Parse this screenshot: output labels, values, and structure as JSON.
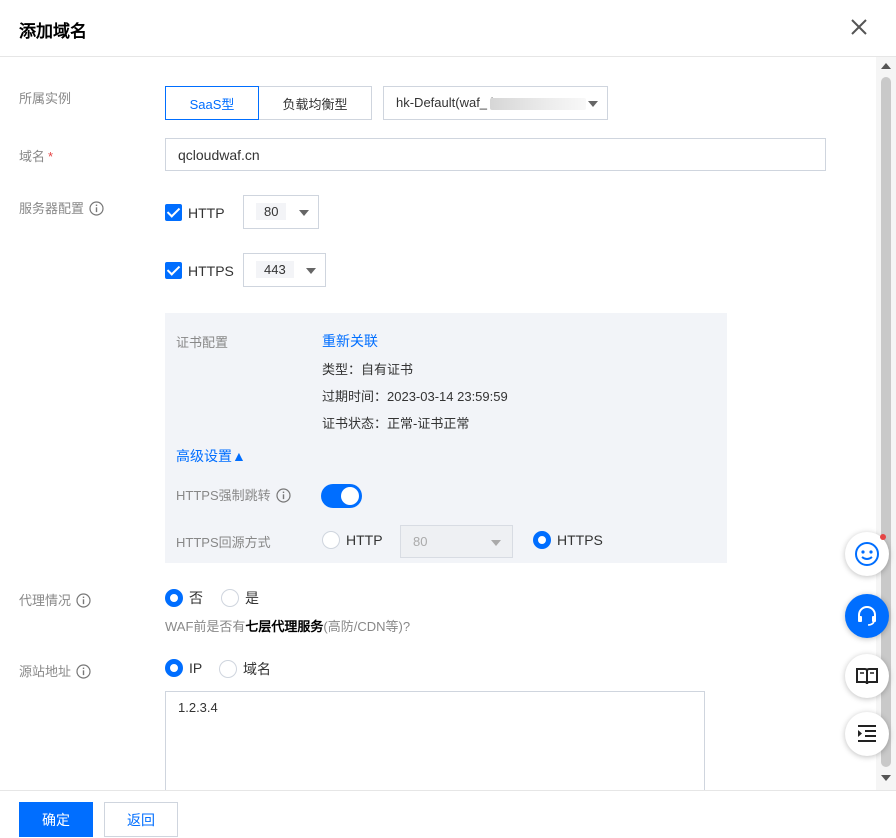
{
  "dialog": {
    "title": "添加域名"
  },
  "instance": {
    "label": "所属实例",
    "type_saas": "SaaS型",
    "type_lb": "负载均衡型",
    "selected": "hk-Default(waf_  kwo."
  },
  "domain": {
    "label": "域名",
    "required_mark": "*",
    "value": "qcloudwaf.cn"
  },
  "server": {
    "label": "服务器配置",
    "http": {
      "label": "HTTP",
      "port": "80"
    },
    "https": {
      "label": "HTTPS",
      "port": "443"
    }
  },
  "cert": {
    "label": "证书配置",
    "relink": "重新关联",
    "type": "类型：自有证书",
    "expire": "过期时间：2023-03-14 23:59:59",
    "status": "证书状态：正常-证书正常"
  },
  "advanced": {
    "toggle_label": "高级设置▲",
    "force_https_label": "HTTPS强制跳转",
    "force_https_on": true,
    "origin_protocol_label": "HTTPS回源方式",
    "origin_http": "HTTP",
    "origin_http_port": "80",
    "origin_https": "HTTPS",
    "origin_selected": "HTTPS"
  },
  "proxy": {
    "label": "代理情况",
    "no": "否",
    "yes": "是",
    "selected": "否",
    "hint_prefix": "WAF前是否有",
    "hint_bold": "七层代理服务",
    "hint_suffix": "(高防/CDN等)?"
  },
  "origin": {
    "label": "源站地址",
    "ip": "IP",
    "domain": "域名",
    "selected": "IP",
    "value": "1.2.3.4"
  },
  "footer": {
    "confirm": "确定",
    "back": "返回"
  },
  "colors": {
    "primary": "#006eff",
    "panel_bg": "#f2f4f8",
    "required": "#e54545"
  },
  "floating": [
    "smiley-icon",
    "headset-icon",
    "book-icon",
    "list-indent-icon"
  ]
}
